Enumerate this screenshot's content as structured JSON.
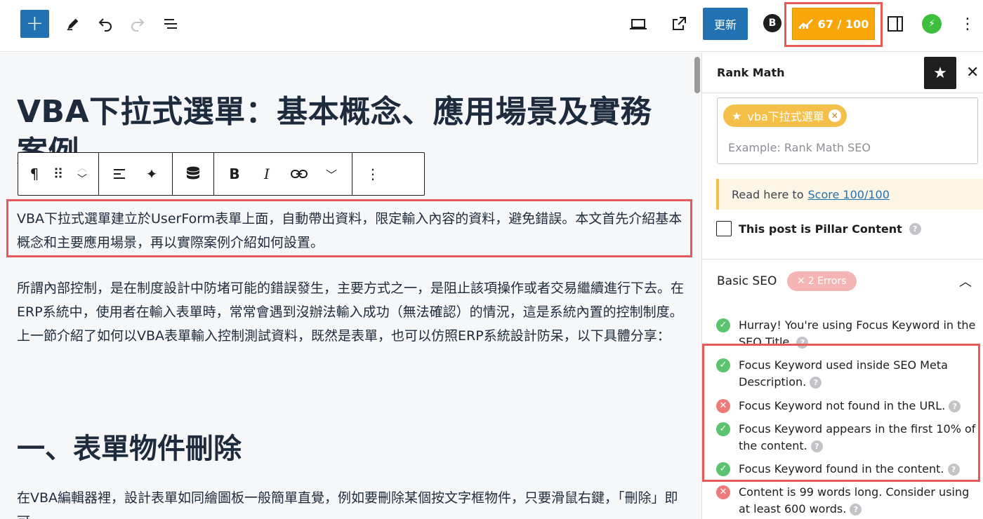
{
  "toolbar": {
    "add_label": "+",
    "update_label": "更新",
    "score_label": "67 / 100",
    "score_value": 67,
    "score_max": 100
  },
  "editor": {
    "title": "VBA下拉式選單：基本概念、應用場景及實務案例",
    "paragraph1": "VBA下拉式選單建立於UserForm表單上面，自動帶出資料，限定輸入內容的資料，避免錯誤。本文首先介紹基本概念和主要應用場景，再以實際案例介紹如何設置。",
    "paragraph2": "所謂內部控制，是在制度設計中防堵可能的錯誤發生，主要方式之一，是阻止該項操作或者交易繼續進行下去。在ERP系統中，使用者在輸入表單時，常常會遇到沒辦法輸入成功（無法確認）的情況，這是系統內置的控制制度。上一節介紹了如何以VBA表單輸入控制測試資料，既然是表單，也可以仿照ERP系統設計防呆，以下具體分享：",
    "heading2": "一、表單物件刪除",
    "paragraph3": "在VBA編輯器裡，設計表單如同繪圖板一般簡單直覺，例如要刪除某個按文字框物件，只要滑鼠右鍵，「刪除」即可。"
  },
  "sidebar": {
    "title": "Rank Math",
    "focus_keyword": "vba下拉式選單",
    "keyword_placeholder": "Example: Rank Math SEO",
    "read_here_prefix": "Read here to",
    "read_here_link": "Score 100/100",
    "pillar_label": "This post is Pillar Content",
    "basic_seo_label": "Basic SEO",
    "errors_label": "2 Errors",
    "checks": [
      {
        "status": "ok",
        "text": "Hurray! You're using Focus Keyword in the SEO Title."
      },
      {
        "status": "ok",
        "text": "Focus Keyword used inside SEO Meta Description."
      },
      {
        "status": "bad",
        "text": "Focus Keyword not found in the URL."
      },
      {
        "status": "ok",
        "text": "Focus Keyword appears in the first 10% of the content."
      },
      {
        "status": "ok",
        "text": "Focus Keyword found in the content."
      },
      {
        "status": "bad",
        "text": "Content is 99 words long. Consider using at least 600 words."
      }
    ]
  },
  "colors": {
    "primary": "#2271b1",
    "score": "#f9a60a",
    "highlight": "#e65a5a",
    "ok": "#5cc36f",
    "error": "#ef7a7a"
  }
}
